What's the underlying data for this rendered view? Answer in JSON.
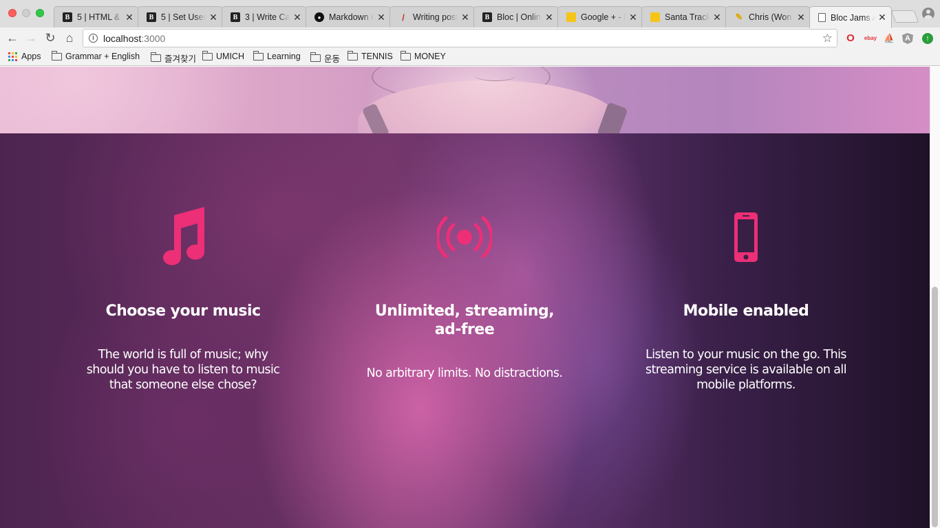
{
  "browser": {
    "tabs": [
      {
        "title": "5 | HTML &",
        "favicon": "bloc-icon"
      },
      {
        "title": "5 | Set User",
        "favicon": "bloc-icon"
      },
      {
        "title": "3 | Write Ca",
        "favicon": "bloc-icon"
      },
      {
        "title": "Markdown C",
        "favicon": "github-icon"
      },
      {
        "title": "Writing post",
        "favicon": "pen-icon"
      },
      {
        "title": "Bloc | Online",
        "favicon": "bloc-icon"
      },
      {
        "title": "Google + - l",
        "favicon": "sheets-icon"
      },
      {
        "title": "Santa Track",
        "favicon": "sheets-icon"
      },
      {
        "title": "Chris (Won",
        "favicon": "pencil-icon"
      },
      {
        "title": "Bloc Jams A",
        "favicon": "page-icon",
        "active": true
      }
    ],
    "close_glyph": "✕",
    "address": {
      "host": "localhost",
      "port": ":3000"
    },
    "bookmarks": {
      "apps_label": "Apps",
      "folders": [
        "Grammar + English",
        "즐겨찾기",
        "UMICH",
        "Learning",
        "운동",
        "TENNIS",
        "MONEY"
      ]
    },
    "extensions": [
      "opera-icon",
      "ebay-icon",
      "ship-icon",
      "angular-icon",
      "update-icon"
    ],
    "ebay_text": "ebay"
  },
  "features": [
    {
      "icon": "music-note-icon",
      "title": "Choose your music",
      "description": "The world is full of music; why should you have to listen to music that someone else chose?"
    },
    {
      "icon": "broadcast-icon",
      "title": "Unlimited, streaming, ad-free",
      "description": "No arbitrary limits. No distractions."
    },
    {
      "icon": "mobile-phone-icon",
      "title": "Mobile enabled",
      "description": "Listen to your music on the go. This streaming service is available on all mobile platforms."
    }
  ],
  "colors": {
    "accent": "#ec2f77",
    "text": "#ffffff"
  }
}
